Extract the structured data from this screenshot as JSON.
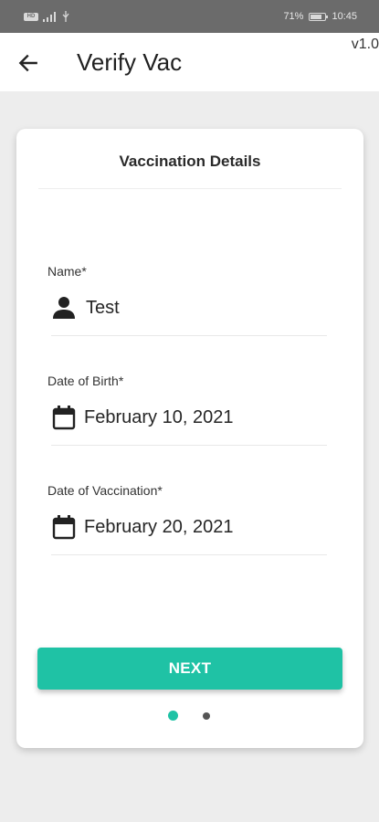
{
  "status_bar": {
    "left_badge": "HD",
    "battery": "71%",
    "time": "10:45"
  },
  "app_bar": {
    "title": "Verify Vac",
    "version": "v1.0"
  },
  "card": {
    "title": "Vaccination Details",
    "fields": [
      {
        "label": "Name*",
        "value": "Test",
        "icon": "person-icon"
      },
      {
        "label": "Date of Birth*",
        "value": "February 10, 2021",
        "icon": "calendar-icon"
      },
      {
        "label": "Date of Vaccination*",
        "value": "February 20, 2021",
        "icon": "calendar-icon"
      }
    ],
    "next_label": "NEXT",
    "pagination": {
      "current": 1,
      "total": 2
    }
  },
  "colors": {
    "accent": "#1fc2a5",
    "status_bar": "#6b6b6b",
    "background": "#ededed"
  }
}
